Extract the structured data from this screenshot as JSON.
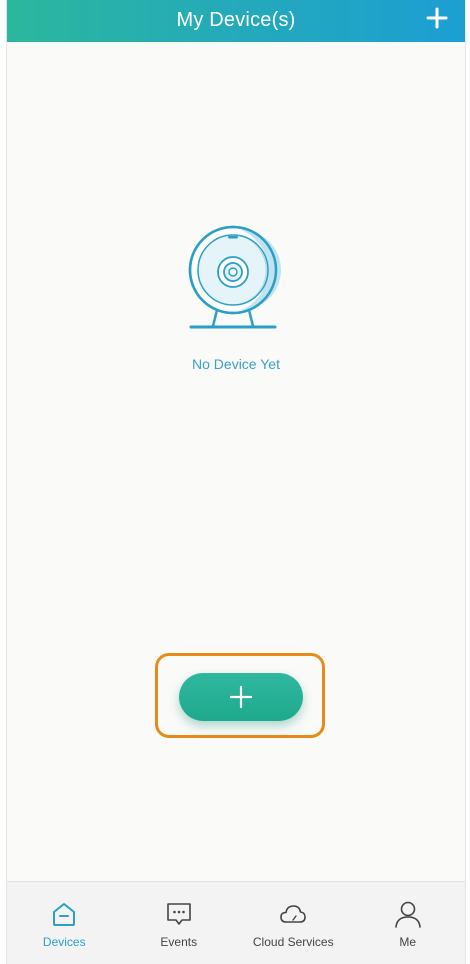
{
  "header": {
    "title": "My Device(s)",
    "add_icon": "plus-icon"
  },
  "empty_state": {
    "illustration": "camera-icon",
    "message": "No Device Yet"
  },
  "add_button": {
    "icon": "plus-icon",
    "highlight_color": "#e88a1a"
  },
  "tabs": [
    {
      "label": "Devices",
      "icon": "home-icon",
      "active": true
    },
    {
      "label": "Events",
      "icon": "chat-icon",
      "active": false
    },
    {
      "label": "Cloud Services",
      "icon": "cloud-icon",
      "active": false
    },
    {
      "label": "Me",
      "icon": "person-icon",
      "active": false
    }
  ],
  "colors": {
    "accent": "#2bb79d",
    "header_gradient_end": "#1c9fd3",
    "active_tab": "#2aa0c8",
    "empty_label": "#3a9fc6"
  }
}
